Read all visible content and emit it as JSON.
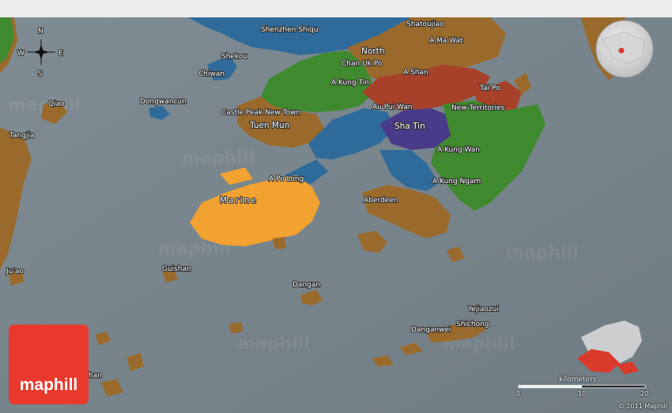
{
  "watermark": "maphill",
  "compass": {
    "n": "N",
    "s": "S",
    "e": "E",
    "w": "W"
  },
  "places": [
    "Shenzhen Shiqu",
    "Shatoujiao",
    "A Ma Wat",
    "North",
    "Chan Uk Po",
    "Shekou",
    "Chiwan",
    "A Shan",
    "A Kung Tin",
    "Tai Po",
    "Dongwancun",
    "Qiao",
    "Castle Peak New Town",
    "Au Pui Wan",
    "New Territories",
    "Tuen Mun",
    "Sha Tin",
    "Tangjia",
    "A Kung Wan",
    "A Po Long",
    "A Kung Ngam",
    "Aberdeen",
    "Marine",
    "Guishan",
    "Ju'ao",
    "Dangan",
    "Yejiaozui",
    "Shichong",
    "Danganwei",
    "han"
  ],
  "colors": {
    "sea": "#7d8a91",
    "land": "#9a6a2c",
    "north": "#3f8a2e",
    "shenzhen": "#2f6b9a",
    "tai_po": "#a8412a",
    "sha_tin": "#4a3a8a",
    "marine": "#f2a230",
    "logo": "#e8392c"
  },
  "logo": {
    "text": "maphill"
  },
  "scale": {
    "unit_label": "kilometers",
    "ticks": [
      "0",
      "10",
      "20"
    ]
  },
  "copyright": "© 2011 Maphill"
}
